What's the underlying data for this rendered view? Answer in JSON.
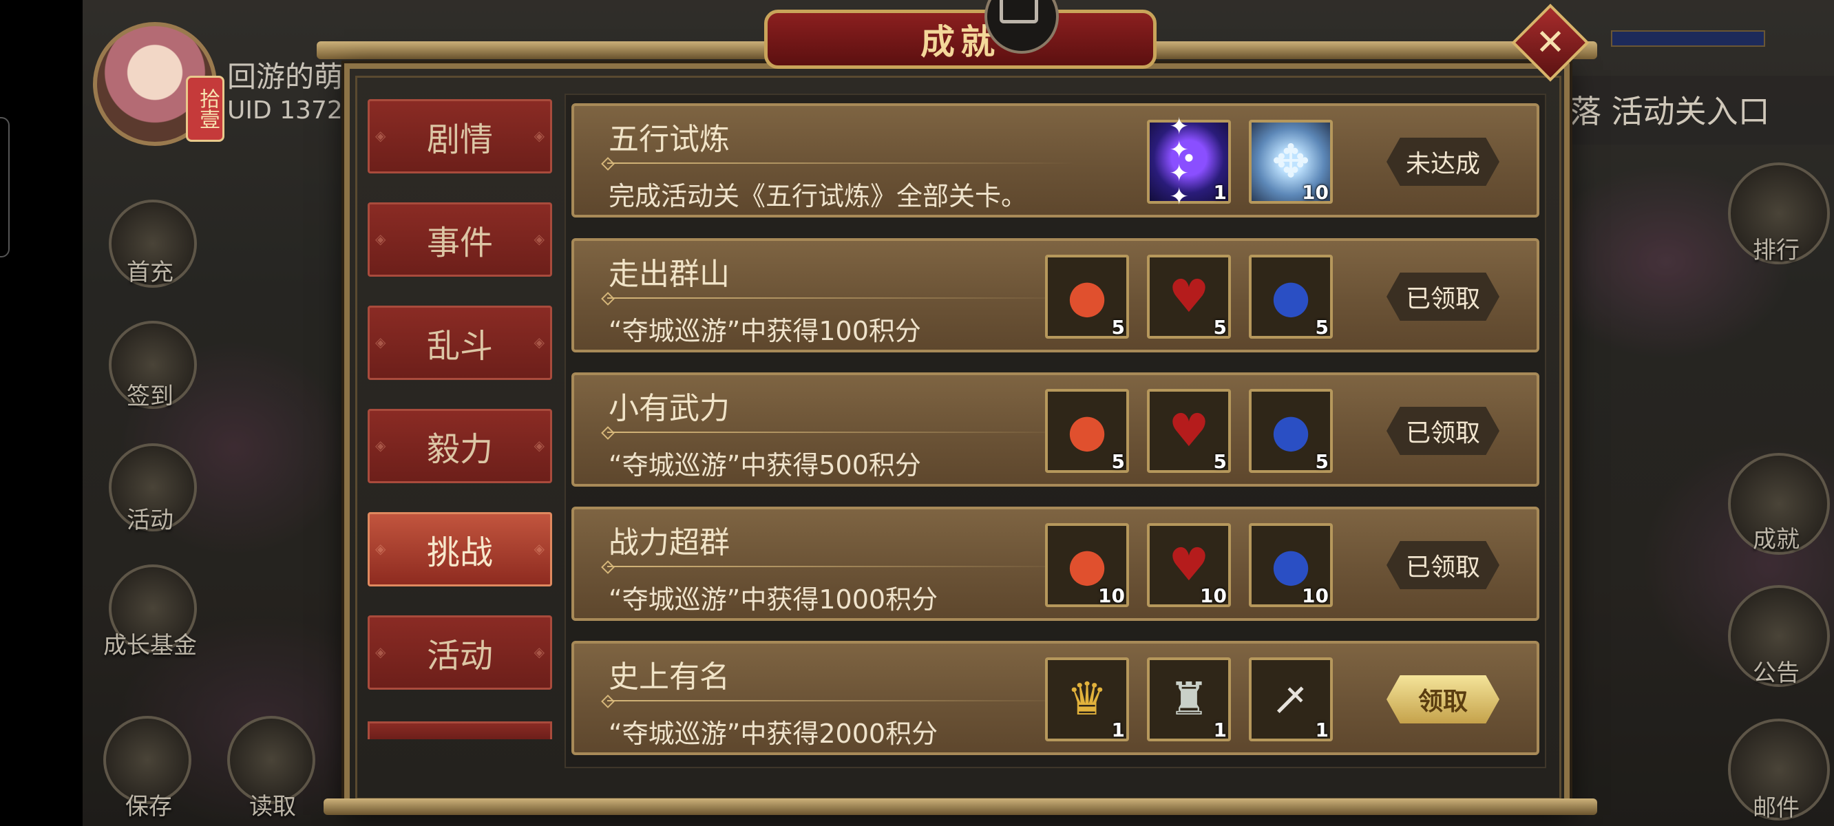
{
  "hud": {
    "player_name": "回游的萌",
    "uid": "UID  1372",
    "avatar_tag": "拾壹",
    "banner": "落 活动关入口",
    "left_buttons": [
      "首充",
      "签到",
      "活动",
      "成长基金",
      "保存",
      "读取"
    ],
    "right_buttons": [
      "排行",
      "成就",
      "公告",
      "邮件"
    ]
  },
  "modal": {
    "title": "成就",
    "close_glyph": "✕"
  },
  "tabs": [
    {
      "label": "剧情",
      "active": false
    },
    {
      "label": "事件",
      "active": false
    },
    {
      "label": "乱斗",
      "active": false
    },
    {
      "label": "毅力",
      "active": false
    },
    {
      "label": "挑战",
      "active": true
    },
    {
      "label": "活动",
      "active": false
    }
  ],
  "achievements": [
    {
      "name": "五行试炼",
      "desc": "完成活动关《五行试炼》全部关卡。",
      "rewards": [
        {
          "item": "five-elements-orbs-icon",
          "count": "1"
        },
        {
          "item": "ice-crystal-icon",
          "count": "10"
        }
      ],
      "status": "未达成"
    },
    {
      "name": "走出群山",
      "desc": "“夺城巡游”中获得100积分",
      "rewards": [
        {
          "item": "red-fruit-icon",
          "count": "5"
        },
        {
          "item": "red-pouch-icon",
          "count": "5"
        },
        {
          "item": "blue-fruit-icon",
          "count": "5"
        }
      ],
      "status": "已领取"
    },
    {
      "name": "小有武力",
      "desc": "“夺城巡游”中获得500积分",
      "rewards": [
        {
          "item": "red-fruit-icon",
          "count": "5"
        },
        {
          "item": "red-pouch-icon",
          "count": "5"
        },
        {
          "item": "blue-fruit-icon",
          "count": "5"
        }
      ],
      "status": "已领取"
    },
    {
      "name": "战力超群",
      "desc": "“夺城巡游”中获得1000积分",
      "rewards": [
        {
          "item": "red-fruit-icon",
          "count": "10"
        },
        {
          "item": "red-pouch-icon",
          "count": "10"
        },
        {
          "item": "blue-fruit-icon",
          "count": "10"
        }
      ],
      "status": "已领取"
    },
    {
      "name": "史上有名",
      "desc": "“夺城巡游”中获得2000积分",
      "rewards": [
        {
          "item": "golden-helmet-icon",
          "count": "1"
        },
        {
          "item": "armor-icon",
          "count": "1"
        },
        {
          "item": "sword-icon",
          "count": "1"
        }
      ],
      "status": "领取"
    }
  ]
}
